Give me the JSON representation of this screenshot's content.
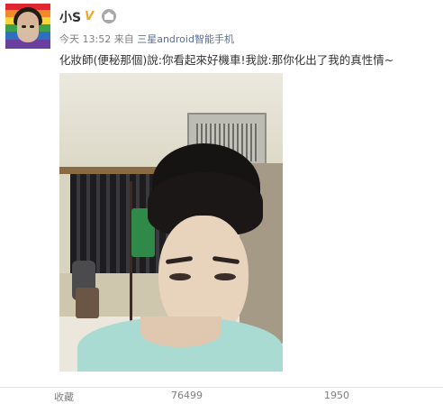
{
  "post": {
    "username": "小S",
    "verified_badge": "V",
    "meta_time": "今天 13:52",
    "meta_from": "来自",
    "meta_source": "三星android智能手机",
    "text": "化妝師(便秘那個)說:你看起來好機車!我說:那你化出了我的真性情~"
  },
  "icons": {
    "avatar": "profile-avatar",
    "verified": "verified-v-icon",
    "member": "member-crown-icon"
  },
  "actions": [
    "收藏",
    "76499",
    "1950"
  ],
  "colors": {
    "verified": "#f5a623",
    "source_link": "#5a6f94",
    "meta_text": "#808080"
  }
}
